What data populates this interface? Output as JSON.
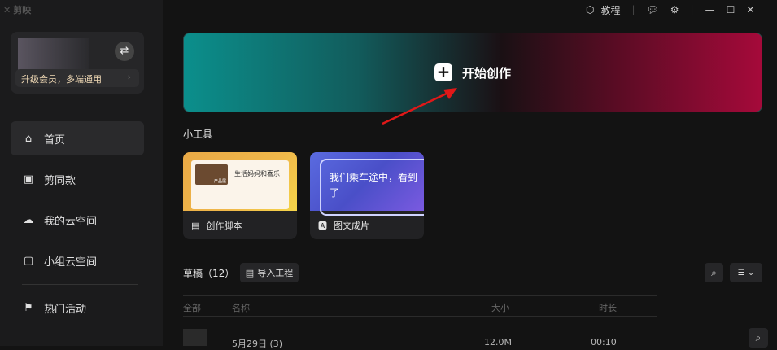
{
  "app": {
    "name": "剪映"
  },
  "topbar": {
    "tutorial": "教程"
  },
  "user": {
    "vip_text": "升级会员，多端通用"
  },
  "sidebar": {
    "items": [
      {
        "label": "首页",
        "icon": "home-icon"
      },
      {
        "label": "剪同款",
        "icon": "template-icon"
      },
      {
        "label": "我的云空间",
        "icon": "cloud-icon"
      },
      {
        "label": "小组云空间",
        "icon": "group-cloud-icon"
      },
      {
        "label": "热门活动",
        "icon": "flag-icon"
      }
    ]
  },
  "banner": {
    "label": "开始创作"
  },
  "tools": {
    "title": "小工具",
    "cards": [
      {
        "label": "创作脚本",
        "preview": "生活妈妈和喜乐",
        "tag": "产品展"
      },
      {
        "label": "图文成片",
        "preview": "我们乘车途中，看到了"
      }
    ]
  },
  "drafts": {
    "title": "草稿",
    "count": "（12）",
    "import": "导入工程",
    "columns": [
      "全部",
      "名称",
      "大小",
      "时长"
    ],
    "rows": [
      {
        "name": "5月29日 (3)",
        "size": "12.0M",
        "duration": "00:10"
      }
    ]
  }
}
